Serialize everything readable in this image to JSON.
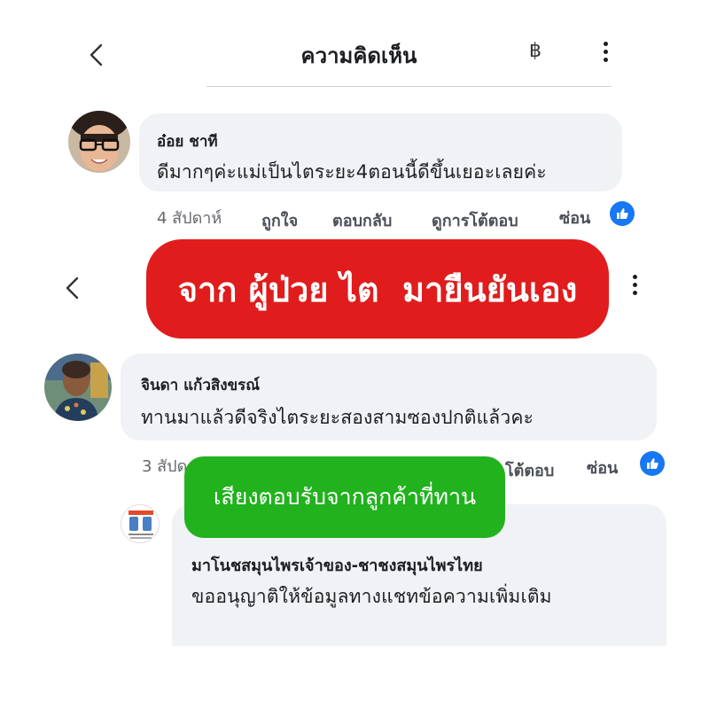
{
  "top_screen": {
    "header": {
      "back_icon": "chevron-left-icon",
      "title": "ความคิดเห็น",
      "currency_symbol": "฿",
      "more_icon": "more-vertical-icon"
    },
    "comment": {
      "author": "อ๋อย ชาที",
      "text": "ดีมากๆค่ะแม่เป็นไตระยะ4ตอนนี้ดีขึ้นเยอะเลยค่ะ",
      "time": "4 สัปดาห์",
      "like_action": "ถูกใจ",
      "reply_action": "ตอบกลับ",
      "view_replies_action": "ดูการโต้ตอบ",
      "hide_action": "ซ่อน",
      "reaction_icon": "thumbs-up-icon"
    }
  },
  "banner_red": {
    "text": "จาก ผู้ป่วย ไต  มายืนยันเอง",
    "color": "#e01c1c"
  },
  "bottom_screen": {
    "header": {
      "back_icon": "chevron-left-icon",
      "more_icon": "more-vertical-icon"
    },
    "comment": {
      "author": "จินดา แก้วสิงขรณ์",
      "text": "ทานมาแล้วดีจริงไตระยะสองสามซองปกติแล้วคะ",
      "time": "3 สัปด",
      "view_replies_partial": "โต้ตอบ",
      "hide_action": "ซ่อน",
      "reaction_icon": "thumbs-up-icon"
    },
    "reply": {
      "author": "มาโนชสมุนไพรเจ้าของ-ชาชงสมุนไพรไทย",
      "text": "ขออนุญาติให้ข้อมูลทางแชทข้อความเพิ่มเติม"
    }
  },
  "banner_green": {
    "text": "เสียงตอบรับจากลูกค้าที่ทาน",
    "color": "#21b21e"
  },
  "colors": {
    "accent_blue": "#1877f2",
    "bubble_gray": "#f0f2f5",
    "meta_gray": "#65676b"
  }
}
